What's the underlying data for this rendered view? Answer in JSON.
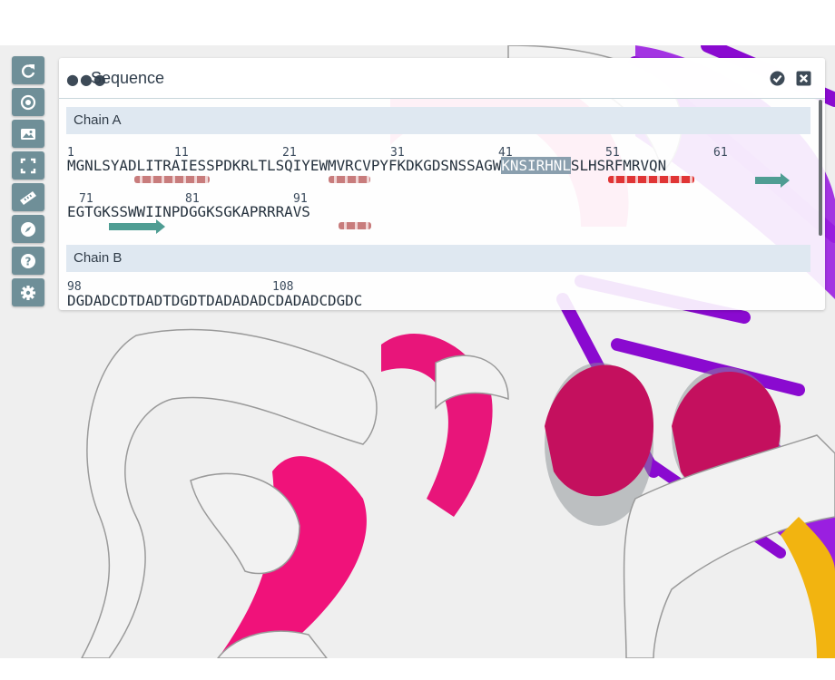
{
  "panel": {
    "title": "Sequence",
    "menu_icon": "dots-icon",
    "check_icon": "check-circle-icon",
    "close_icon": "close-square-icon"
  },
  "toolbar": {
    "buttons": [
      {
        "name": "reset-view",
        "icon": "refresh-icon"
      },
      {
        "name": "focus",
        "icon": "target-icon"
      },
      {
        "name": "screenshot",
        "icon": "image-icon"
      },
      {
        "name": "fullscreen",
        "icon": "expand-icon"
      },
      {
        "name": "measure",
        "icon": "ruler-icon"
      },
      {
        "name": "navigate",
        "icon": "compass-icon"
      },
      {
        "name": "help",
        "icon": "question-icon"
      },
      {
        "name": "settings",
        "icon": "gear-icon"
      }
    ]
  },
  "chains": [
    {
      "label": "Chain A",
      "lines": [
        {
          "numbers": [
            "1",
            "11",
            "21",
            "31",
            "41",
            "51",
            "61"
          ],
          "pre": "MGNLSYADLITRAIESSPDKRLTLSQIYEWMVRCVPYFKDKGDSNSSAGW",
          "highlight": "KNSIRHNL",
          "post": "SLHSRFMRVQN"
        },
        {
          "numbers": [
            "71",
            "81",
            "91"
          ],
          "text": "EGTGKSSWWIINPDGGKSGKAPRRRAVS"
        }
      ]
    },
    {
      "label": "Chain B",
      "lines": [
        {
          "numbers": [
            "98",
            "108"
          ],
          "text": "DGDADCDTDADTDGDTDADADADCDADADCDGDC"
        }
      ]
    }
  ],
  "colors": {
    "toolbar": "#6f8f98",
    "chain_bg": "#dfe8f1",
    "helix": "#c87c7c",
    "helix_selected": "#e03535",
    "strand": "#4f9d93",
    "selection": "#8a9fae",
    "ribbon_pink": "#f0127a",
    "ribbon_purple": "#8a0ad0",
    "ribbon_white": "#f2f2f2"
  }
}
